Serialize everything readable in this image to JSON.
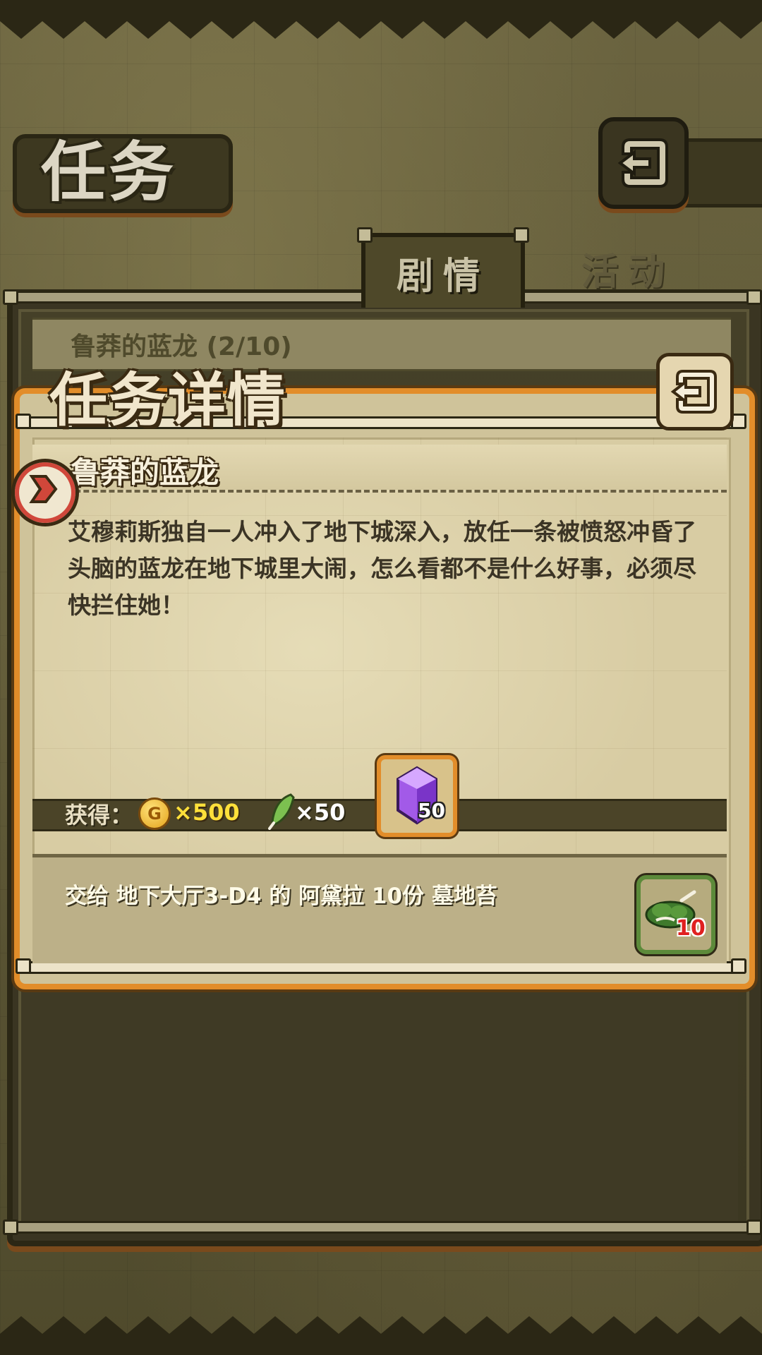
{
  "header": {
    "title": "任务",
    "back_icon": "back-arrow-icon"
  },
  "tabs": [
    {
      "label": "剧情",
      "active": true
    },
    {
      "label": "活动",
      "active": false
    }
  ],
  "quest_list": {
    "entry_title": "鲁莽的蓝龙 (2/10)"
  },
  "detail": {
    "title": "任务详情",
    "back_icon": "back-arrow-icon",
    "quest_name": "鲁莽的蓝龙",
    "description": "艾穆莉斯独自一人冲入了地下城深入，放任一条被愤怒冲昏了头脑的蓝龙在地下城里大闹，怎么看都不是什么好事，必须尽快拦住她！",
    "rewards": {
      "label": "获得：",
      "coin_icon_letter": "G",
      "coin_amount": "×500",
      "feather_amount": "×50",
      "gem_count": "50"
    },
    "objective": "交给 地下大厅3-D4  的 阿黛拉 10份 墓地苔",
    "item_count": "10",
    "colors": {
      "accent_orange": "#e28d2a",
      "coin_yellow": "#ffe03a",
      "item_count_red": "#e02020"
    }
  }
}
